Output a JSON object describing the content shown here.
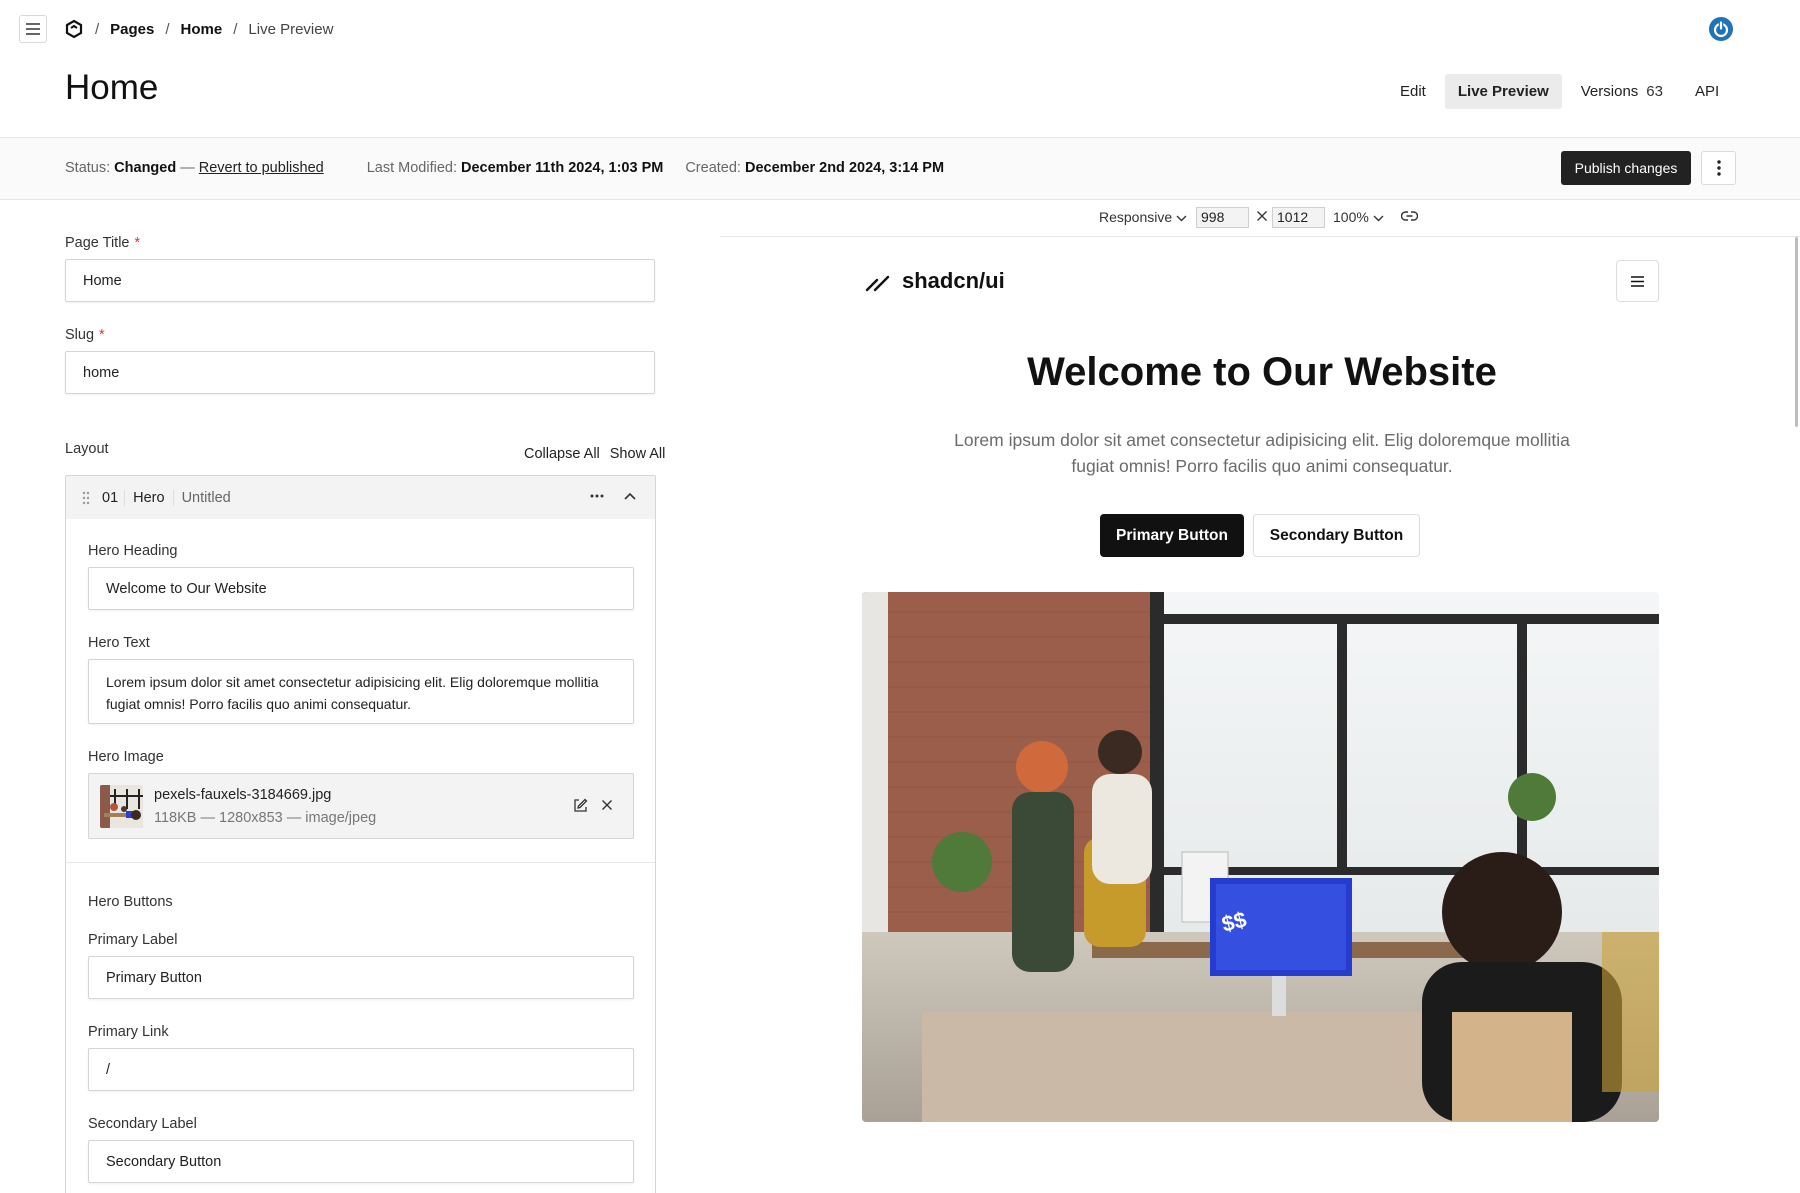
{
  "breadcrumb": {
    "items": [
      "Pages",
      "Home",
      "Live Preview"
    ],
    "separator": "/"
  },
  "page": {
    "title": "Home"
  },
  "tabs": [
    {
      "label": "Edit"
    },
    {
      "label": "Live Preview",
      "active": true
    },
    {
      "label": "Versions",
      "count": "63"
    },
    {
      "label": "API"
    }
  ],
  "status": {
    "status_label": "Status:",
    "status_value": "Changed",
    "dash": "—",
    "revert_label": "Revert to published",
    "modified_label": "Last Modified:",
    "modified_value": "December 11th 2024, 1:03 PM",
    "created_label": "Created:",
    "created_value": "December 2nd 2024, 3:14 PM",
    "publish_label": "Publish changes"
  },
  "form": {
    "page_title": {
      "label": "Page Title",
      "required": "*",
      "value": "Home"
    },
    "slug": {
      "label": "Slug",
      "required": "*",
      "value": "home"
    },
    "layout": {
      "label": "Layout",
      "collapse_all": "Collapse All",
      "show_all": "Show All"
    },
    "block": {
      "number": "01",
      "type": "Hero",
      "name": "Untitled",
      "hero_heading": {
        "label": "Hero Heading",
        "value": "Welcome to Our Website"
      },
      "hero_text": {
        "label": "Hero Text",
        "value": "Lorem ipsum dolor sit amet consectetur adipisicing elit. Elig doloremque mollitia fugiat omnis! Porro facilis quo animi consequatur."
      },
      "hero_image": {
        "label": "Hero Image",
        "filename": "pexels-fauxels-3184669.jpg",
        "meta": "118KB — 1280x853 — image/jpeg"
      },
      "hero_buttons": {
        "label": "Hero Buttons"
      },
      "primary_label": {
        "label": "Primary Label",
        "value": "Primary Button"
      },
      "primary_link": {
        "label": "Primary Link",
        "value": "/"
      },
      "secondary_label": {
        "label": "Secondary Label",
        "value": "Secondary Button"
      }
    }
  },
  "preview_toolbar": {
    "mode": "Responsive",
    "width": "998",
    "height": "1012",
    "zoom": "100%"
  },
  "preview": {
    "site_name": "shadcn/ui",
    "heading": "Welcome to Our Website",
    "text": "Lorem ipsum dolor sit amet consectetur adipisicing elit. Elig doloremque mollitia fugiat omnis! Porro facilis quo animi consequatur.",
    "primary_button": "Primary Button",
    "secondary_button": "Secondary Button"
  },
  "colors": {
    "accent": "#1f73b7",
    "primary": "#222222",
    "required": "#dd3333"
  }
}
